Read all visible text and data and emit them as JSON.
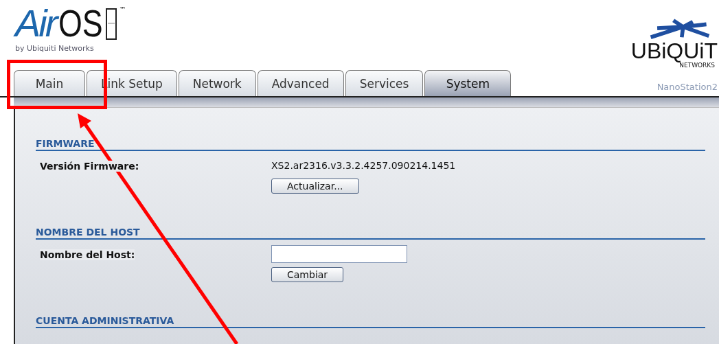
{
  "logo": {
    "air": "Air",
    "os": "OS",
    "tm": "™",
    "byline": "by Ubiquiti Networks"
  },
  "brand": {
    "name": "UBiQUiT",
    "sub": "NETWORKS"
  },
  "tabs": [
    {
      "label": "Main",
      "selected": false
    },
    {
      "label": "Link Setup",
      "selected": false
    },
    {
      "label": "Network",
      "selected": false
    },
    {
      "label": "Advanced",
      "selected": false
    },
    {
      "label": "Services",
      "selected": false
    },
    {
      "label": "System",
      "selected": true
    }
  ],
  "device": "NanoStation2",
  "sections": [
    {
      "title": "FIRMWARE",
      "rows": [
        {
          "kind": "text",
          "label": "Versión Firmware:",
          "value": "XS2.ar2316.v3.3.2.4257.090214.1451"
        },
        {
          "kind": "button",
          "label": "Actualizar..."
        }
      ]
    },
    {
      "title": "NOMBRE DEL HOST",
      "rows": [
        {
          "kind": "input",
          "label": "Nombre del Host:"
        },
        {
          "kind": "button",
          "label": "Cambiar"
        }
      ]
    },
    {
      "title": "CUENTA ADMINISTRATIVA"
    }
  ]
}
